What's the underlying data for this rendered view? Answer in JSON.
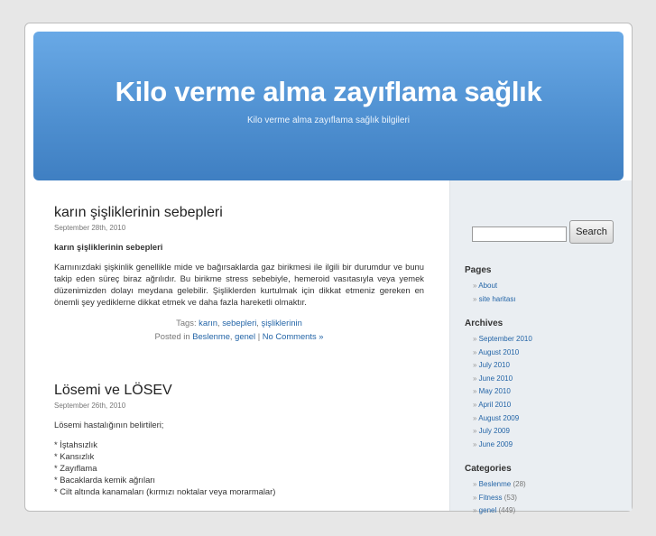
{
  "header": {
    "title": "Kilo verme alma zayıflama sağlık",
    "description": "Kilo verme alma zayıflama sağlık bilgileri"
  },
  "posts": [
    {
      "title": "karın şişliklerinin sebepleri",
      "date": "September 28th, 2010",
      "intro": "karın şişliklerinin sebepleri",
      "body": "Karnınızdaki şişkinlik genellikle mide ve bağırsaklarda gaz birikmesi ile ilgili bir durumdur ve bunu takip eden süreç biraz ağrılıdır. Bu birikme stress sebebiyle, hemeroid vasıtasıyla veya yemek düzenimizden dolayı meydana gelebilir. Şişliklerden kurtulmak için dikkat etmeniz gereken en önemli şey yediklerne dikkat etmek ve daha fazla hareketli olmaktır.",
      "tags_label": "Tags:",
      "tags": [
        "karın",
        "sebepleri",
        "şişliklerinin"
      ],
      "posted_in_label": "Posted in",
      "categories": [
        "Beslenme",
        "genel"
      ],
      "separator": "|",
      "comments": "No Comments »"
    },
    {
      "title": "Lösemi ve LÖSEV",
      "date": "September 26th, 2010",
      "intro": "Lösemi hastalığının belirtileri;",
      "symptoms": [
        "* İştahsızlık",
        "* Kansızlık",
        "* Zayıflama",
        "* Bacaklarda kemik ağrıları",
        "* Cilt altında kanamaları (kırmızı noktalar veya morarmalar)"
      ]
    }
  ],
  "sidebar": {
    "search_button": "Search",
    "search_value": "",
    "pages_title": "Pages",
    "pages": [
      "About",
      "site haritası"
    ],
    "archives_title": "Archives",
    "archives": [
      "September 2010",
      "August 2010",
      "July 2010",
      "June 2010",
      "May 2010",
      "April 2010",
      "August 2009",
      "July 2009",
      "June 2009"
    ],
    "categories_title": "Categories",
    "categories": [
      {
        "name": "Beslenme",
        "count": "(28)"
      },
      {
        "name": "Fitness",
        "count": "(53)"
      },
      {
        "name": "genel",
        "count": "(449)"
      }
    ]
  },
  "colors": {
    "header_blue": "#4e8fd0",
    "link": "#2465a7",
    "sidebar_bg": "#eaeef2"
  }
}
